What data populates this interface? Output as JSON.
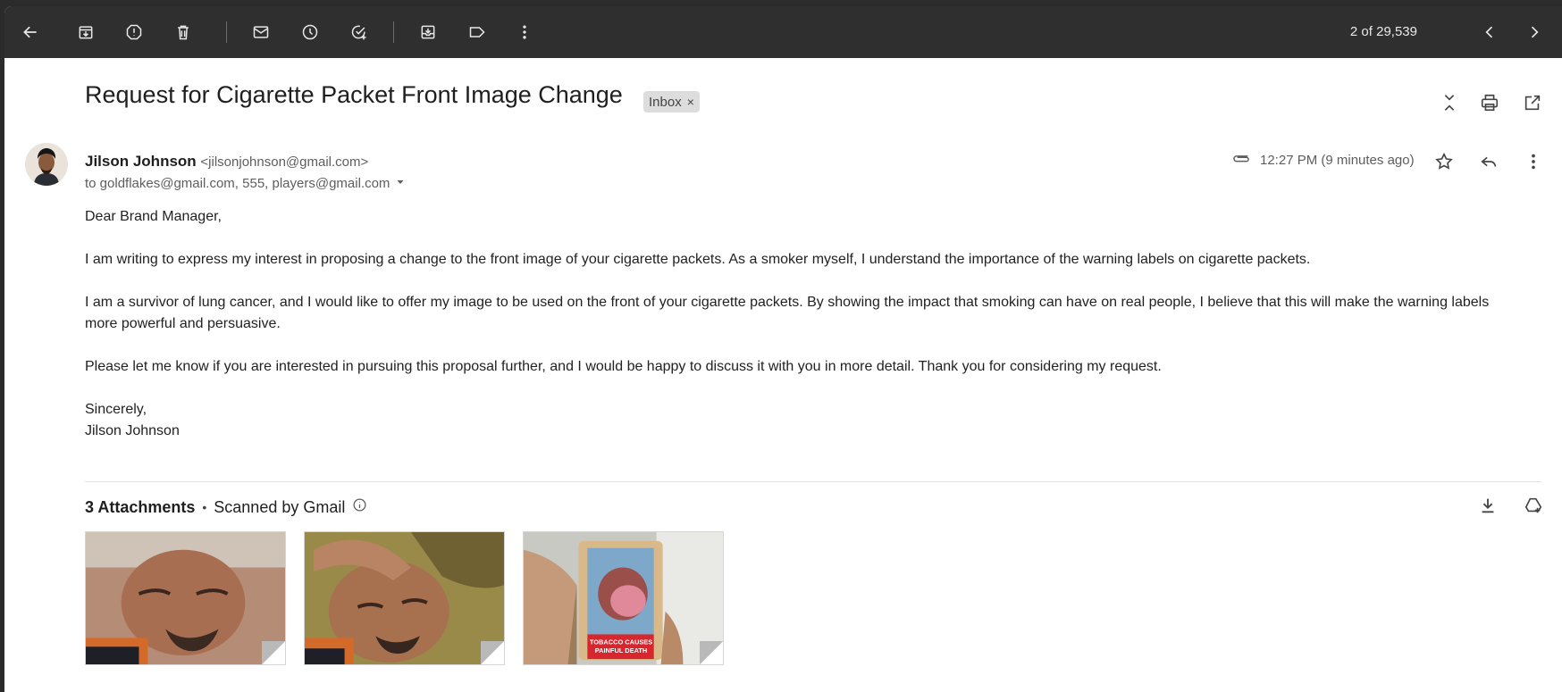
{
  "toolbar": {
    "pager": "2 of 29,539",
    "icons": [
      "back-arrow-icon",
      "archive-icon",
      "report-spam-icon",
      "delete-icon",
      "mark-unread-icon",
      "snooze-icon",
      "add-task-icon",
      "move-to-icon",
      "label-icon",
      "more-vert-icon",
      "prev-icon",
      "next-icon"
    ]
  },
  "email": {
    "subject": "Request for Cigarette Packet Front Image Change",
    "label": "Inbox",
    "label_close": "×",
    "sender_name": "Jilson Johnson",
    "sender_email": "<jilsonjohnson@gmail.com>",
    "recipients": "to goldflakes@gmail.com, 555, players@gmail.com",
    "time": "12:27 PM (9 minutes ago)",
    "body": {
      "greeting": "Dear Brand Manager,",
      "p1": "I am writing to express my interest in proposing a change to the front image of your cigarette packets. As a smoker myself, I understand the importance of the warning labels on cigarette packets.",
      "p2": "I am a survivor of lung cancer, and I would like to offer my image to be used on the front of your cigarette packets. By showing the impact that smoking can have on real people, I believe that this will make the warning labels more powerful and persuasive.",
      "p3": "Please let me know if you are interested in pursuing this proposal further, and I would be happy to discuss it with you in more detail. Thank you for considering my request.",
      "signoff": "Sincerely,",
      "signature": "Jilson Johnson"
    }
  },
  "attachments": {
    "count_label": "3 Attachments",
    "separator": "•",
    "scanned": "Scanned by Gmail",
    "pack_warning_line1": "TOBACCO CAUSES",
    "pack_warning_line2": "PAINFUL DEATH"
  },
  "colors": {
    "toolbar_bg": "#2f2f2f",
    "toolbar_icon": "#e8e8e8",
    "chip_bg": "#dddddd",
    "muted_text": "#5e5e5e"
  }
}
